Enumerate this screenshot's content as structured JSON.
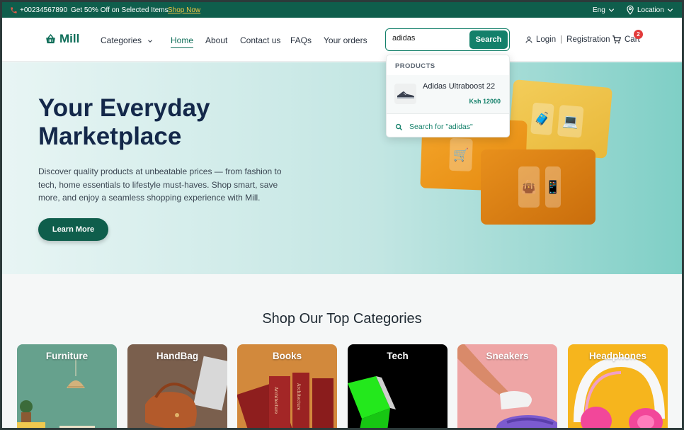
{
  "topbar": {
    "phone": "+00234567890",
    "promo": "Get 50% Off on Selected Items",
    "shop_now": "Shop Now",
    "language": "Eng",
    "location": "Location"
  },
  "header": {
    "logo": "Mill",
    "nav": [
      {
        "label": "Categories"
      },
      {
        "label": "Home"
      },
      {
        "label": "About"
      },
      {
        "label": "Contact us"
      },
      {
        "label": "FAQs"
      },
      {
        "label": "Your orders"
      }
    ],
    "search": {
      "value": "adidas",
      "button": "Search"
    },
    "login": "Login",
    "registration": "Registration",
    "cart": "Cart",
    "cart_count": "2"
  },
  "search_dropdown": {
    "heading": "PRODUCTS",
    "results": [
      {
        "name": "Adidas Ultraboost 22",
        "price": "Ksh 12000"
      }
    ],
    "search_for": "Search for \"adidas\""
  },
  "hero": {
    "title": "Your Everyday Marketplace",
    "description": "Discover quality products at unbeatable prices — from fashion to tech, home essentials to lifestyle must-haves. Shop smart, save more, and enjoy a seamless shopping experience with Mill.",
    "cta": "Learn More"
  },
  "categories": {
    "title": "Shop Our Top Categories",
    "items": [
      {
        "label": "Furniture",
        "color": "#5f9a87"
      },
      {
        "label": "HandBag",
        "color": "#8a6a55"
      },
      {
        "label": "Books",
        "color": "#d2893c"
      },
      {
        "label": "Tech",
        "color": "#000000"
      },
      {
        "label": "Sneakers",
        "color": "#e9a3a3"
      },
      {
        "label": "Headphones",
        "color": "#f6b51d"
      }
    ]
  },
  "colors": {
    "brand": "#0f5e4c",
    "accent": "#13806a",
    "promo_link": "#f2c744",
    "badge": "#e23b3b"
  },
  "icons": [
    "phone-icon",
    "chevron-down-icon",
    "location-pin-icon",
    "basket-icon",
    "user-icon",
    "cart-icon",
    "search-icon"
  ]
}
